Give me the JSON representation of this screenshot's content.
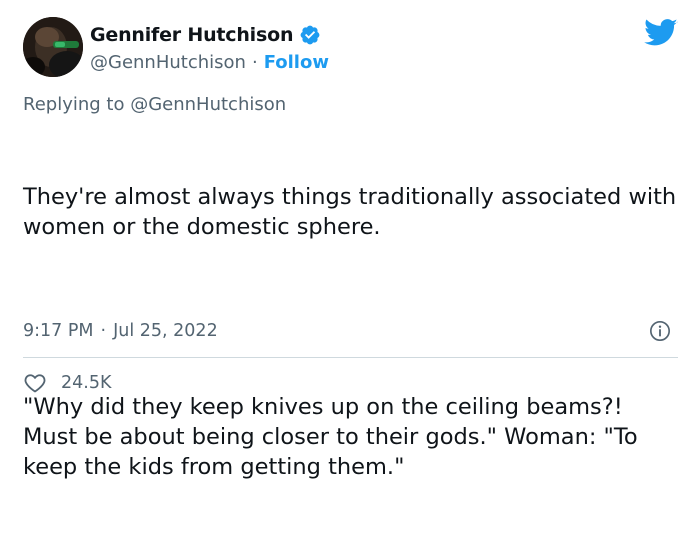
{
  "author": {
    "display_name": "Gennifer Hutchison",
    "handle": "@GennHutchison",
    "separator": "·",
    "follow_label": "Follow",
    "verified": true
  },
  "reply": {
    "prefix": "Replying to",
    "mention": "@GennHutchison"
  },
  "tweet": {
    "paragraph_1": "They're almost always things traditionally associated with women or the domestic sphere.",
    "paragraph_2": "\"Why did they keep knives up on the ceiling beams?! Must be about being closer to their gods.\" Woman: \"To keep the kids from getting them.\""
  },
  "meta": {
    "time": "9:17 PM",
    "separator": "·",
    "date": "Jul 25, 2022"
  },
  "engagement": {
    "likes": "24.5K"
  },
  "icons": {
    "verified": "verified-badge-icon",
    "logo": "twitter-bird-icon",
    "info": "info-icon",
    "like": "heart-icon"
  },
  "colors": {
    "accent": "#1d9bf0",
    "secondary_text": "#536471",
    "primary_text": "#0f1419",
    "divider": "#cfd9de"
  }
}
